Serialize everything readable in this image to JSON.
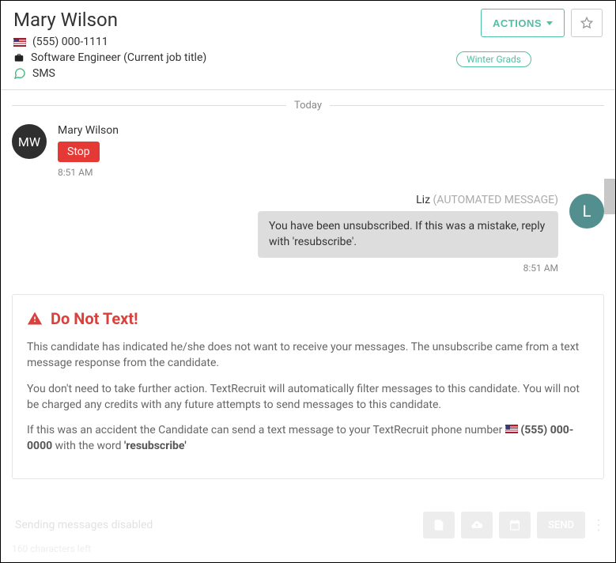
{
  "header": {
    "name": "Mary Wilson",
    "phone": "(555) 000-1111",
    "job_title": "Software Engineer (Current job title)",
    "channel": "SMS",
    "actions_label": "ACTIONS",
    "tags": [
      "Winter Grads"
    ]
  },
  "conversation": {
    "divider": "Today",
    "incoming": {
      "initials": "MW",
      "sender": "Mary Wilson",
      "text": "Stop",
      "time": "8:51 AM"
    },
    "outgoing": {
      "initials": "L",
      "sender": "Liz",
      "tag": "(AUTOMATED MESSAGE)",
      "text": "You have been unsubscribed. If this was a mistake, reply with 'resubscribe'.",
      "time": "8:51 AM"
    }
  },
  "warning": {
    "title": "Do Not Text!",
    "p1": "This candidate has indicated he/she does not want to receive your messages. The unsubscribe came from a text message response from the candidate.",
    "p2": "You don't need to take further action. TextRecruit will automatically filter messages to this candidate. You will not be charged any credits with any future attempts to send messages to this candidate.",
    "p3_pre": "If this was an accident the Candidate can send a text message to your TextRecruit phone number ",
    "p3_phone": "(555) 000-0000",
    "p3_mid": " with the word ",
    "p3_word": "'resubscribe'"
  },
  "composer": {
    "placeholder": "Sending messages disabled",
    "send_label": "SEND",
    "chars_left": "160 characters left"
  }
}
